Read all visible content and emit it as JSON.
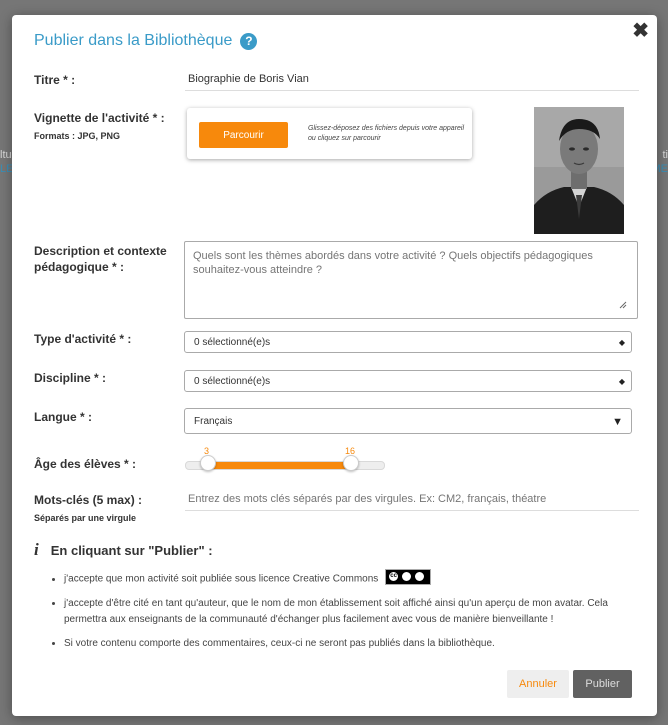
{
  "background": {
    "left_lines": [
      "ltu",
      "LE"
    ],
    "right_lines": [
      "ti",
      "ME"
    ]
  },
  "modal": {
    "title": "Publier dans la Bibliothèque",
    "help_icon": "question-circle-icon",
    "close_icon": "close-icon",
    "close_symbol": "✖"
  },
  "form": {
    "title_label": "Titre * :",
    "title_value": "Biographie de Boris Vian",
    "thumbnail_label": "Vignette de l'activité * :",
    "thumbnail_formats": "Formats : JPG, PNG",
    "browse_label": "Parcourir",
    "drop_hint": "Glissez-déposez des fichiers depuis votre appareil ou cliquez sur parcourir",
    "description_label": "Description et contexte pédagogique * :",
    "description_placeholder": "Quels sont les thèmes abordés dans votre activité ? Quels objectifs pédagogiques souhaitez-vous atteindre ?",
    "activity_type_label": "Type d'activité * :",
    "activity_type_value": "0 sélectionné(e)s",
    "discipline_label": "Discipline * :",
    "discipline_value": "0 sélectionné(e)s",
    "language_label": "Langue * :",
    "language_value": "Français",
    "age_label": "Âge des élèves * :",
    "age_min": 3,
    "age_max": 16,
    "age_min_label": "3",
    "age_max_label": "16",
    "keywords_label": "Mots-clés (5 max) :",
    "keywords_sublabel": "Séparés par une virgule",
    "keywords_placeholder": "Entrez des mots clés séparés par des virgules. Ex: CM2, français, théatre"
  },
  "notice": {
    "icon": "info-icon",
    "title": "En cliquant sur \"Publier\" :",
    "items": [
      "j'accepte que mon activité soit publiée sous licence Creative Commons",
      "j'accepte d'être cité en tant qu'auteur, que le nom de mon établissement soit affiché ainsi qu'un aperçu de mon avatar. Cela permettra aux enseignants de la communauté d'échanger plus facilement avec vous de manière bienveillante !",
      "Si votre contenu comporte des commentaires, ceux-ci ne seront pas publiés dans la bibliothèque."
    ]
  },
  "buttons": {
    "cancel": "Annuler",
    "publish": "Publier"
  },
  "colors": {
    "accent": "#f7890c",
    "title_blue": "#3a9bc8",
    "publish_bg": "#616161"
  }
}
